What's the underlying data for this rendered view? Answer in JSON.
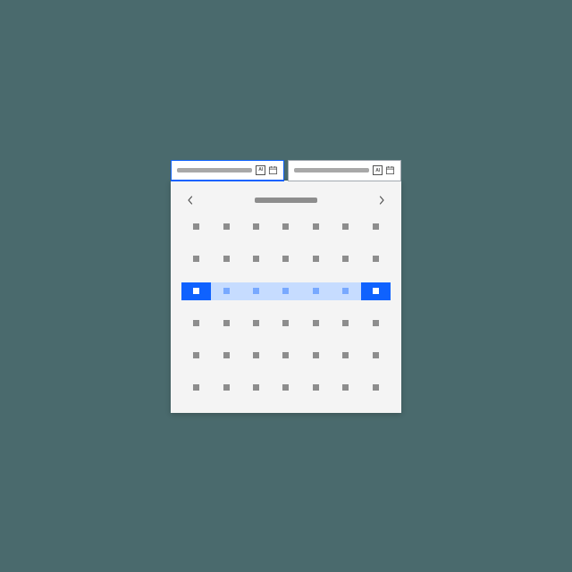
{
  "icons": {
    "ai_label": "AI"
  },
  "inputs": {
    "start": {
      "active": true
    },
    "end": {
      "active": false
    }
  },
  "calendar": {
    "rows": 6,
    "cols": 7,
    "range_row": 2,
    "range_start_col": 0,
    "range_end_col": 6
  }
}
